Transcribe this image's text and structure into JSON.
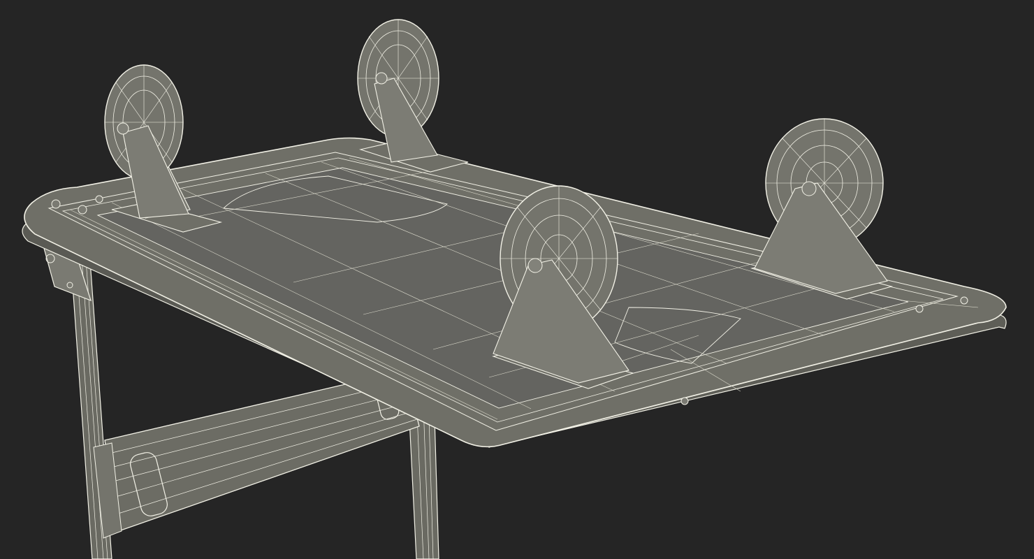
{
  "scene": {
    "subject": "",
    "render_style": "wireframe",
    "colors": {
      "background": "#252525",
      "surface": "#6f6f67",
      "surface_dark": "#5f5f58",
      "wire": "#f2f1e6",
      "wire_soft": "#d8d7c9"
    },
    "components": {
      "casters": 4,
      "legs": 2,
      "crossbar": 1
    }
  }
}
